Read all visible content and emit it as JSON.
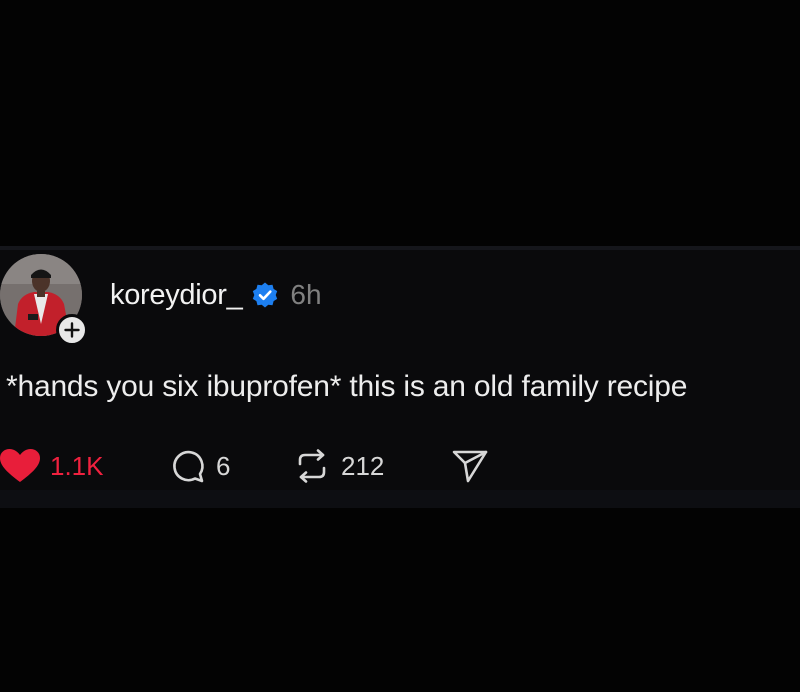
{
  "post": {
    "username": "koreydior_",
    "timestamp": "6h",
    "text": "*hands you six ibuprofen* this is an old family recipe",
    "stats": {
      "likes": "1.1K",
      "replies": "6",
      "reposts": "212"
    }
  },
  "icons": {
    "like": "heart-filled-icon",
    "reply": "speech-bubble-icon",
    "repost": "repost-arrows-icon",
    "share": "paper-plane-icon",
    "verified": "verified-badge-icon",
    "follow": "plus-icon"
  },
  "colors": {
    "background": "#030303",
    "card": "#0a0a0c",
    "like_active": "#f0213f",
    "verified_blue": "#1d7ff0",
    "muted_text": "#808080"
  }
}
